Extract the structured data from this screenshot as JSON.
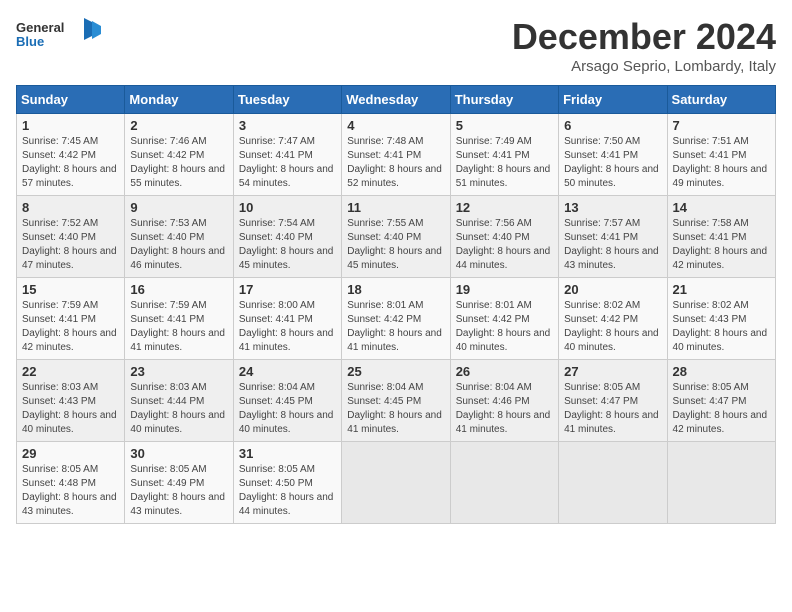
{
  "logo": {
    "general": "General",
    "blue": "Blue"
  },
  "header": {
    "month_year": "December 2024",
    "location": "Arsago Seprio, Lombardy, Italy"
  },
  "weekdays": [
    "Sunday",
    "Monday",
    "Tuesday",
    "Wednesday",
    "Thursday",
    "Friday",
    "Saturday"
  ],
  "weeks": [
    [
      {
        "day": "1",
        "sunrise": "Sunrise: 7:45 AM",
        "sunset": "Sunset: 4:42 PM",
        "daylight": "Daylight: 8 hours and 57 minutes."
      },
      {
        "day": "2",
        "sunrise": "Sunrise: 7:46 AM",
        "sunset": "Sunset: 4:42 PM",
        "daylight": "Daylight: 8 hours and 55 minutes."
      },
      {
        "day": "3",
        "sunrise": "Sunrise: 7:47 AM",
        "sunset": "Sunset: 4:41 PM",
        "daylight": "Daylight: 8 hours and 54 minutes."
      },
      {
        "day": "4",
        "sunrise": "Sunrise: 7:48 AM",
        "sunset": "Sunset: 4:41 PM",
        "daylight": "Daylight: 8 hours and 52 minutes."
      },
      {
        "day": "5",
        "sunrise": "Sunrise: 7:49 AM",
        "sunset": "Sunset: 4:41 PM",
        "daylight": "Daylight: 8 hours and 51 minutes."
      },
      {
        "day": "6",
        "sunrise": "Sunrise: 7:50 AM",
        "sunset": "Sunset: 4:41 PM",
        "daylight": "Daylight: 8 hours and 50 minutes."
      },
      {
        "day": "7",
        "sunrise": "Sunrise: 7:51 AM",
        "sunset": "Sunset: 4:41 PM",
        "daylight": "Daylight: 8 hours and 49 minutes."
      }
    ],
    [
      {
        "day": "8",
        "sunrise": "Sunrise: 7:52 AM",
        "sunset": "Sunset: 4:40 PM",
        "daylight": "Daylight: 8 hours and 47 minutes."
      },
      {
        "day": "9",
        "sunrise": "Sunrise: 7:53 AM",
        "sunset": "Sunset: 4:40 PM",
        "daylight": "Daylight: 8 hours and 46 minutes."
      },
      {
        "day": "10",
        "sunrise": "Sunrise: 7:54 AM",
        "sunset": "Sunset: 4:40 PM",
        "daylight": "Daylight: 8 hours and 45 minutes."
      },
      {
        "day": "11",
        "sunrise": "Sunrise: 7:55 AM",
        "sunset": "Sunset: 4:40 PM",
        "daylight": "Daylight: 8 hours and 45 minutes."
      },
      {
        "day": "12",
        "sunrise": "Sunrise: 7:56 AM",
        "sunset": "Sunset: 4:40 PM",
        "daylight": "Daylight: 8 hours and 44 minutes."
      },
      {
        "day": "13",
        "sunrise": "Sunrise: 7:57 AM",
        "sunset": "Sunset: 4:41 PM",
        "daylight": "Daylight: 8 hours and 43 minutes."
      },
      {
        "day": "14",
        "sunrise": "Sunrise: 7:58 AM",
        "sunset": "Sunset: 4:41 PM",
        "daylight": "Daylight: 8 hours and 42 minutes."
      }
    ],
    [
      {
        "day": "15",
        "sunrise": "Sunrise: 7:59 AM",
        "sunset": "Sunset: 4:41 PM",
        "daylight": "Daylight: 8 hours and 42 minutes."
      },
      {
        "day": "16",
        "sunrise": "Sunrise: 7:59 AM",
        "sunset": "Sunset: 4:41 PM",
        "daylight": "Daylight: 8 hours and 41 minutes."
      },
      {
        "day": "17",
        "sunrise": "Sunrise: 8:00 AM",
        "sunset": "Sunset: 4:41 PM",
        "daylight": "Daylight: 8 hours and 41 minutes."
      },
      {
        "day": "18",
        "sunrise": "Sunrise: 8:01 AM",
        "sunset": "Sunset: 4:42 PM",
        "daylight": "Daylight: 8 hours and 41 minutes."
      },
      {
        "day": "19",
        "sunrise": "Sunrise: 8:01 AM",
        "sunset": "Sunset: 4:42 PM",
        "daylight": "Daylight: 8 hours and 40 minutes."
      },
      {
        "day": "20",
        "sunrise": "Sunrise: 8:02 AM",
        "sunset": "Sunset: 4:42 PM",
        "daylight": "Daylight: 8 hours and 40 minutes."
      },
      {
        "day": "21",
        "sunrise": "Sunrise: 8:02 AM",
        "sunset": "Sunset: 4:43 PM",
        "daylight": "Daylight: 8 hours and 40 minutes."
      }
    ],
    [
      {
        "day": "22",
        "sunrise": "Sunrise: 8:03 AM",
        "sunset": "Sunset: 4:43 PM",
        "daylight": "Daylight: 8 hours and 40 minutes."
      },
      {
        "day": "23",
        "sunrise": "Sunrise: 8:03 AM",
        "sunset": "Sunset: 4:44 PM",
        "daylight": "Daylight: 8 hours and 40 minutes."
      },
      {
        "day": "24",
        "sunrise": "Sunrise: 8:04 AM",
        "sunset": "Sunset: 4:45 PM",
        "daylight": "Daylight: 8 hours and 40 minutes."
      },
      {
        "day": "25",
        "sunrise": "Sunrise: 8:04 AM",
        "sunset": "Sunset: 4:45 PM",
        "daylight": "Daylight: 8 hours and 41 minutes."
      },
      {
        "day": "26",
        "sunrise": "Sunrise: 8:04 AM",
        "sunset": "Sunset: 4:46 PM",
        "daylight": "Daylight: 8 hours and 41 minutes."
      },
      {
        "day": "27",
        "sunrise": "Sunrise: 8:05 AM",
        "sunset": "Sunset: 4:47 PM",
        "daylight": "Daylight: 8 hours and 41 minutes."
      },
      {
        "day": "28",
        "sunrise": "Sunrise: 8:05 AM",
        "sunset": "Sunset: 4:47 PM",
        "daylight": "Daylight: 8 hours and 42 minutes."
      }
    ],
    [
      {
        "day": "29",
        "sunrise": "Sunrise: 8:05 AM",
        "sunset": "Sunset: 4:48 PM",
        "daylight": "Daylight: 8 hours and 43 minutes."
      },
      {
        "day": "30",
        "sunrise": "Sunrise: 8:05 AM",
        "sunset": "Sunset: 4:49 PM",
        "daylight": "Daylight: 8 hours and 43 minutes."
      },
      {
        "day": "31",
        "sunrise": "Sunrise: 8:05 AM",
        "sunset": "Sunset: 4:50 PM",
        "daylight": "Daylight: 8 hours and 44 minutes."
      },
      null,
      null,
      null,
      null
    ]
  ]
}
